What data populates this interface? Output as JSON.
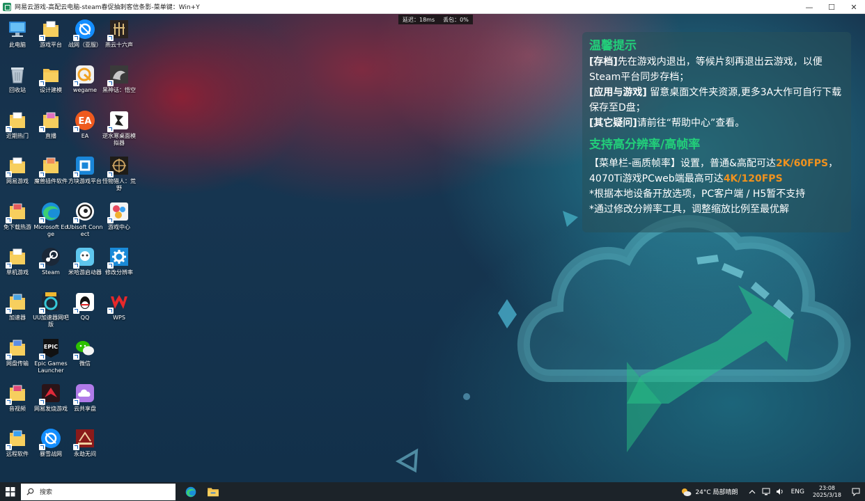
{
  "window": {
    "title": "网易云游戏-高配云电脑-steam春促抽刺客信条影-菜单键：Win+Y",
    "minimize": "—",
    "maximize": "☐",
    "close": "✕"
  },
  "stats": {
    "latency": "延迟：18ms",
    "loss": "丢包：0%"
  },
  "icons": [
    {
      "label": "此电脑",
      "icon": "computer-icon"
    },
    {
      "label": "游戏平台",
      "icon": "folder-icon"
    },
    {
      "label": "战网（亚服）",
      "icon": "battlenet-icon"
    },
    {
      "label": "燕云十六声",
      "icon": "game-icon"
    },
    {
      "label": "回收站",
      "icon": "recycle-bin-icon"
    },
    {
      "label": "设计建模",
      "icon": "folder-icon"
    },
    {
      "label": "wegame",
      "icon": "wegame-icon"
    },
    {
      "label": "黑神话：悟空",
      "icon": "game-icon"
    },
    {
      "label": "近期热门",
      "icon": "folder-icon"
    },
    {
      "label": "直播",
      "icon": "folder-icon"
    },
    {
      "label": "EA",
      "icon": "ea-icon"
    },
    {
      "label": "逆水寒桌面模拟器",
      "icon": "game-icon"
    },
    {
      "label": "网易游戏",
      "icon": "folder-icon"
    },
    {
      "label": "魔兽插件软件",
      "icon": "folder-icon"
    },
    {
      "label": "方块游戏平台",
      "icon": "cube-icon"
    },
    {
      "label": "怪物猎人：荒野",
      "icon": "game-icon"
    },
    {
      "label": "免下载热游",
      "icon": "folder-icon"
    },
    {
      "label": "Microsoft Edge",
      "icon": "edge-icon"
    },
    {
      "label": "Ubisoft Connect",
      "icon": "ubisoft-icon"
    },
    {
      "label": "游戏中心",
      "icon": "game-center-icon"
    },
    {
      "label": "单机游戏",
      "icon": "folder-icon"
    },
    {
      "label": "Steam",
      "icon": "steam-icon"
    },
    {
      "label": "米哈游启动器",
      "icon": "mihoyo-icon"
    },
    {
      "label": "修改分辨率",
      "icon": "gear-icon"
    },
    {
      "label": "加速器",
      "icon": "folder-icon"
    },
    {
      "label": "UU加速器网吧版",
      "icon": "uu-icon"
    },
    {
      "label": "QQ",
      "icon": "qq-icon"
    },
    {
      "label": "WPS",
      "icon": "wps-icon"
    },
    {
      "label": "网盘传输",
      "icon": "folder-icon"
    },
    {
      "label": "Epic Games Launcher",
      "icon": "epic-icon"
    },
    {
      "label": "微信",
      "icon": "wechat-icon"
    },
    {
      "label": "音视频",
      "icon": "folder-icon"
    },
    {
      "label": "网易发烧游戏",
      "icon": "netease-fever-icon"
    },
    {
      "label": "云共享盘",
      "icon": "cloud-drive-icon"
    },
    {
      "label": "远程软件",
      "icon": "folder-icon"
    },
    {
      "label": "暴雪战网",
      "icon": "battlenet-icon"
    },
    {
      "label": "永劫无间",
      "icon": "game-icon"
    }
  ],
  "notice": {
    "heading1": "温馨提示",
    "l1_tag": "[存档]",
    "l1_text": "先在游戏内退出，等候片刻再退出云游戏，以便Steam平台同步存档；",
    "l2_tag": "[应用与游戏]",
    "l2_text": " 留意桌面文件夹资源,更多3A大作可自行下载保存至D盘；",
    "l3_tag": "[其它疑问]",
    "l3_text": "请前往“帮助中心”查看。",
    "heading2": "支持高分辨率/高帧率",
    "l4_text": "【菜单栏-画质帧率】设置，普通&高配可达",
    "l4_hl": "2K/60FPS",
    "l4_end": "，",
    "l5_text": "4070Ti游戏PCweb端最高可达",
    "l5_hl": "4K/120FPS",
    "l6_text": "*根据本地设备开放选项，PC客户端 / H5暂不支持",
    "l7_text": "*通过修改分辨率工具，调整缩放比例至最优解"
  },
  "taskbar": {
    "search_placeholder": "搜索",
    "weather": "24°C  局部晴朗",
    "lang": "ENG",
    "time": "23:08",
    "date": "2025/3/18"
  }
}
